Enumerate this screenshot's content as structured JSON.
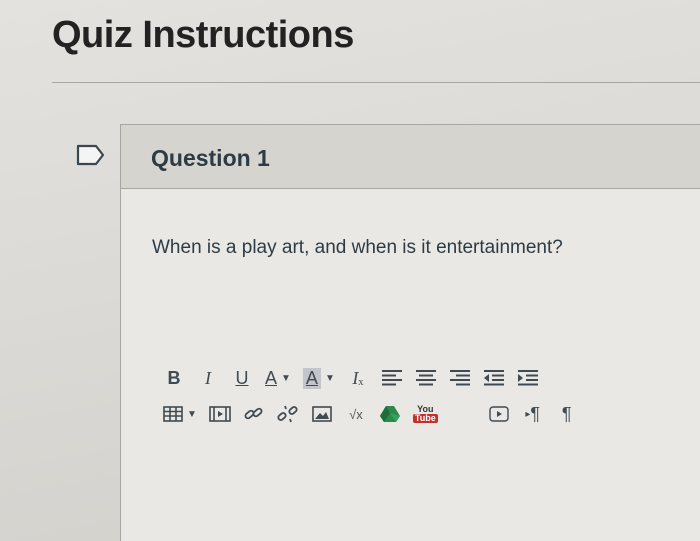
{
  "page": {
    "title": "Quiz Instructions"
  },
  "question": {
    "title": "Question 1",
    "text": "When is a play art, and when is it entertainment?",
    "flag_icon": "bookmark-flag-icon"
  },
  "toolbar": {
    "row1": [
      {
        "name": "bold-button",
        "label": "B"
      },
      {
        "name": "italic-button",
        "label": "I"
      },
      {
        "name": "underline-button",
        "label": "U"
      },
      {
        "name": "text-color-button",
        "label": "A"
      },
      {
        "name": "background-color-button",
        "label": "A"
      },
      {
        "name": "clear-formatting-button",
        "label": "I"
      },
      {
        "name": "align-left-icon"
      },
      {
        "name": "align-center-icon"
      },
      {
        "name": "align-right-icon"
      },
      {
        "name": "outdent-icon"
      },
      {
        "name": "indent-icon"
      }
    ],
    "row2": [
      {
        "name": "table-icon"
      },
      {
        "name": "media-icon"
      },
      {
        "name": "link-icon"
      },
      {
        "name": "unlink-icon"
      },
      {
        "name": "image-icon"
      },
      {
        "name": "math-equation-icon",
        "label": "√x"
      },
      {
        "name": "google-drive-icon"
      },
      {
        "name": "youtube-icon",
        "label_top": "You",
        "label_bottom": "Tube"
      },
      {
        "name": "video-embed-icon"
      },
      {
        "name": "ltr-paragraph-icon",
        "label": "¶"
      },
      {
        "name": "rtl-paragraph-icon",
        "label": "¶"
      }
    ]
  },
  "colors": {
    "text": "#2d3b45",
    "panel": "#eae8e4",
    "header": "#d6d4cf",
    "youtube_red": "#c4302b"
  }
}
